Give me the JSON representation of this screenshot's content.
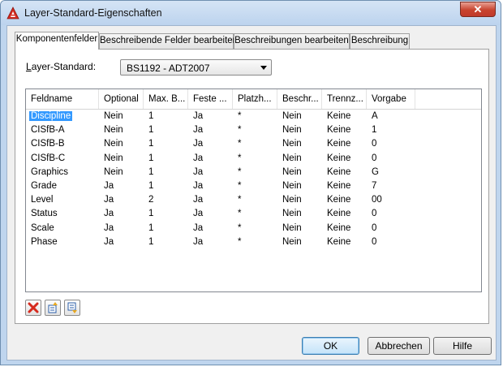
{
  "window": {
    "title": "Layer-Standard-Eigenschaften",
    "close_label": "✕"
  },
  "tabs": [
    {
      "label": "Komponentenfelder",
      "active": true
    },
    {
      "label": "Beschreibende Felder bearbeiten",
      "active": false
    },
    {
      "label": "Beschreibungen bearbeiten",
      "active": false
    },
    {
      "label": "Beschreibung",
      "active": false
    }
  ],
  "standard": {
    "label_prefix": "",
    "label_underlined": "L",
    "label_rest": "ayer-Standard:",
    "value": "BS1192 - ADT2007"
  },
  "table": {
    "columns": [
      "Feldname",
      "Optional",
      "Max. B...",
      "Feste ...",
      "Platzh...",
      "Beschr...",
      "Trennz...",
      "Vorgabe"
    ],
    "rows": [
      [
        "Discipline",
        "Nein",
        "1",
        "Ja",
        "*",
        "Nein",
        "Keine",
        "A"
      ],
      [
        "CISfB-A",
        "Nein",
        "1",
        "Ja",
        "*",
        "Nein",
        "Keine",
        "1"
      ],
      [
        "CISfB-B",
        "Nein",
        "1",
        "Ja",
        "*",
        "Nein",
        "Keine",
        "0"
      ],
      [
        "CISfB-C",
        "Nein",
        "1",
        "Ja",
        "*",
        "Nein",
        "Keine",
        "0"
      ],
      [
        "Graphics",
        "Nein",
        "1",
        "Ja",
        "*",
        "Nein",
        "Keine",
        "G"
      ],
      [
        "Grade",
        "Ja",
        "1",
        "Ja",
        "*",
        "Nein",
        "Keine",
        "7"
      ],
      [
        "Level",
        "Ja",
        "2",
        "Ja",
        "*",
        "Nein",
        "Keine",
        "00"
      ],
      [
        "Status",
        "Ja",
        "1",
        "Ja",
        "*",
        "Nein",
        "Keine",
        "0"
      ],
      [
        "Scale",
        "Ja",
        "1",
        "Ja",
        "*",
        "Nein",
        "Keine",
        "0"
      ],
      [
        "Phase",
        "Ja",
        "1",
        "Ja",
        "*",
        "Nein",
        "Keine",
        "0"
      ]
    ],
    "selected_row": 0
  },
  "toolbar": {
    "icons": [
      "delete-icon",
      "move-up-icon",
      "move-down-icon"
    ]
  },
  "buttons": {
    "ok": "OK",
    "cancel": "Abbrechen",
    "help": "Hilfe"
  },
  "colors": {
    "accent": "#3399ff",
    "titlebar": "#bcd3ee",
    "close": "#c8432e",
    "app_icon": "#d42a20"
  }
}
